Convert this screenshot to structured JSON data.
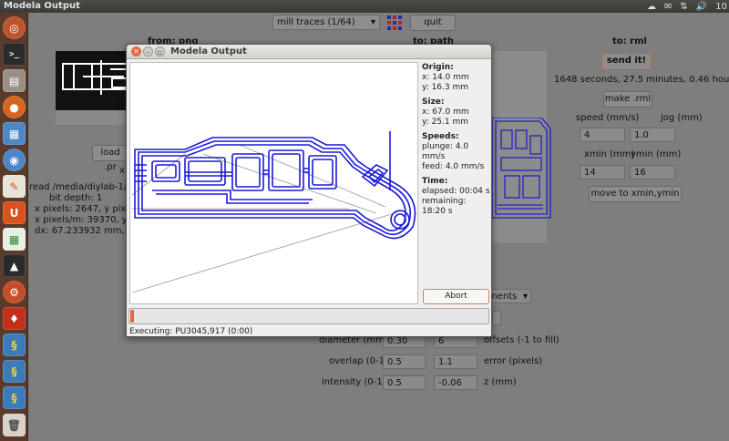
{
  "topbar": {
    "title": "Modela Output",
    "clock": "10"
  },
  "launcher": {
    "icons": [
      "ubuntu-home-icon",
      "terminal-icon",
      "files-icon",
      "firefox-icon",
      "document-icon",
      "chromium-icon",
      "writer-icon",
      "ubuntu-one-icon",
      "calc-icon",
      "inkscape-icon",
      "settings-icon",
      "pen-icon",
      "python-icon",
      "python-icon",
      "python-icon",
      "trash-icon"
    ]
  },
  "app": {
    "toolbar": {
      "selector_value": "mill traces (1/64)",
      "quit_label": "quit"
    },
    "headers": {
      "from_png": "from: png",
      "to_path": "to: path",
      "to_rml": "to: rml"
    },
    "left": {
      "load_label": "load .pr",
      "x_label": "x:",
      "lines": [
        "read /media/diylab-1/MA",
        "bit depth: 1",
        "x pixels: 2647, y pixels: 9",
        "x pixels/m: 39370, y pixel",
        "dx: 67.233932 mm, dy: 25."
      ]
    },
    "right": {
      "send_label": "send it!",
      "time_text": "1648 seconds, 27.5 minutes, 0.46 hours",
      "make_label": "make .rml",
      "speed_label": "speed (mm/s)",
      "jog_label": "jog (mm)",
      "speed_value": "4",
      "jog_value": "1.0",
      "xmin_label": "xmin (mm)",
      "ymin_label": "ymin (mm)",
      "xmin_value": "14",
      "ymin_value": "16",
      "move_label": "move to xmin,ymin"
    },
    "middle": {
      "dropdown_value": "ments",
      "diameter_label": "diameter (mm)",
      "diameter_value": "0.30",
      "offsets_value": "6",
      "offsets_label": "offsets (-1 to fill)",
      "overlap_label": "overlap (0-1)",
      "overlap_value": "0.5",
      "error_value": "1.1",
      "error_label": "error (pixels)",
      "intensity_label": "intensity (0-1)",
      "intensity_value": "0.5",
      "z_value": "-0.06",
      "z_label": "z (mm)"
    }
  },
  "modal": {
    "title": "Modela Output",
    "origin_label": "Origin:",
    "origin_x": "x: 14.0 mm",
    "origin_y": "y: 16.3 mm",
    "size_label": "Size:",
    "size_x": "x: 67.0 mm",
    "size_y": "y: 25.1 mm",
    "speeds_label": "Speeds:",
    "plunge": "plunge: 4.0 mm/s",
    "feed": "feed: 4.0 mm/s",
    "time_label": "Time:",
    "elapsed": "elapsed: 00:04 s",
    "remaining": "remaining: 18:20 s",
    "abort_label": "Abort",
    "progress": 0.01,
    "status": "Executing: PU3045,917 (0:00)"
  },
  "colors": {
    "toolpath": "#1a1ad6",
    "accent": "#e5683f",
    "launcher": "#5a3a2b"
  }
}
